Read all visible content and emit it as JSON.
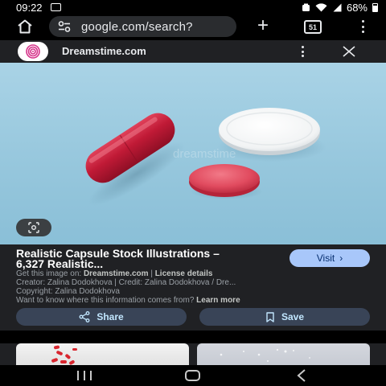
{
  "status_bar": {
    "time": "09:22",
    "battery": "68%",
    "icons": [
      "gallery-icon",
      "alarm-icon",
      "wifi-icon",
      "signal-icon",
      "battery-icon"
    ]
  },
  "browser": {
    "url": "google.com/search?",
    "tab_count": "51",
    "icons": [
      "home-icon",
      "tune-icon",
      "plus-icon",
      "tabs-icon",
      "more-vert-icon"
    ]
  },
  "sheet": {
    "site_name": "Dreamstime.com",
    "icons": [
      "dreamstime-logo",
      "more-vert-icon",
      "close-icon",
      "lens-icon"
    ]
  },
  "result": {
    "title": "Realistic Capsule Stock Illustrations – 6,327 Realistic...",
    "visit_label": "Visit",
    "get_image_prefix": "Get this image on:",
    "get_image_site": "Dreamstime.com",
    "separator": "|",
    "license": "License details",
    "creator_line": "Creator: Zalina Dodokhova | Credit: Zalina Dodokhova / Dre...",
    "copyright_line": "Copyright: Zalina Dodokhova",
    "want_to_know": "Want to know where this information comes from?",
    "learn_more": "Learn more",
    "share_label": "Share",
    "save_label": "Save"
  },
  "colors": {
    "sheet_bg": "#202124",
    "visit_bg": "#a8c7fa",
    "pill_button_bg": "#394457",
    "image_bg": "#9ecbe0",
    "capsule": "#c41e3a",
    "round_pill": "#e0475d"
  }
}
